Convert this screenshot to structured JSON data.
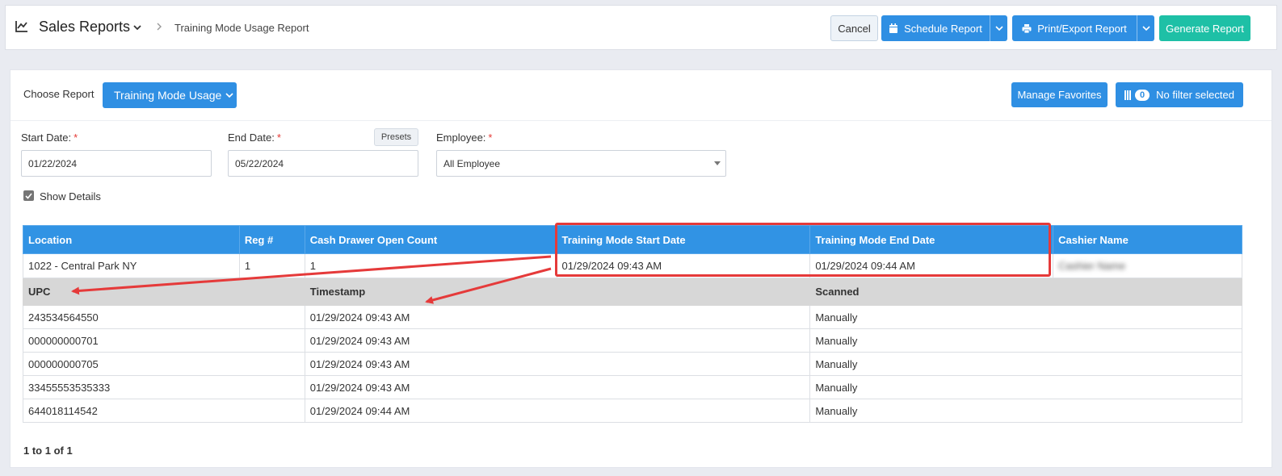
{
  "header": {
    "title": "Sales Reports",
    "breadcrumb": "Training Mode Usage Report",
    "buttons": {
      "cancel": "Cancel",
      "schedule": "Schedule Report",
      "print": "Print/Export Report",
      "generate": "Generate Report"
    }
  },
  "controls": {
    "choose_report_label": "Choose Report",
    "report_selected": "Training Mode Usage",
    "manage_favorites": "Manage Favorites",
    "filter_count": "0",
    "filter_label": "No filter selected",
    "start_date": {
      "label": "Start Date:",
      "value": "01/22/2024"
    },
    "end_date": {
      "label": "End Date:",
      "value": "05/22/2024"
    },
    "presets": "Presets",
    "employee": {
      "label": "Employee:",
      "value": "All Employee"
    },
    "required_mark": "*",
    "show_details": "Show Details"
  },
  "table": {
    "columns": [
      "Location",
      "Reg #",
      "Cash Drawer Open Count",
      "Training Mode Start Date",
      "Training Mode End Date",
      "Cashier Name"
    ],
    "row": {
      "location": "1022 - Central Park NY",
      "reg": "1",
      "cash_drawer_count": "1",
      "start": "01/29/2024 09:43 AM",
      "end": "01/29/2024 09:44 AM",
      "cashier": "Cashier Name"
    },
    "detail_columns": [
      "UPC",
      "Timestamp",
      "Scanned"
    ],
    "detail_rows": [
      {
        "upc": "243534564550",
        "timestamp": "01/29/2024 09:43 AM",
        "scanned": "Manually"
      },
      {
        "upc": "000000000701",
        "timestamp": "01/29/2024 09:43 AM",
        "scanned": "Manually"
      },
      {
        "upc": "000000000705",
        "timestamp": "01/29/2024 09:43 AM",
        "scanned": "Manually"
      },
      {
        "upc": "33455553535333",
        "timestamp": "01/29/2024 09:43 AM",
        "scanned": "Manually"
      },
      {
        "upc": "644018114542",
        "timestamp": "01/29/2024 09:44 AM",
        "scanned": "Manually"
      }
    ]
  },
  "pager": "1 to 1 of 1",
  "colors": {
    "primary": "#2f8fe3",
    "teal": "#1ec0a6",
    "annotation": "#e53a3a"
  },
  "icons": [
    "chart-line-icon",
    "chevron-down-icon",
    "chevron-right-icon",
    "calendar-icon",
    "printer-icon",
    "filter-icon",
    "checkbox-icon"
  ]
}
